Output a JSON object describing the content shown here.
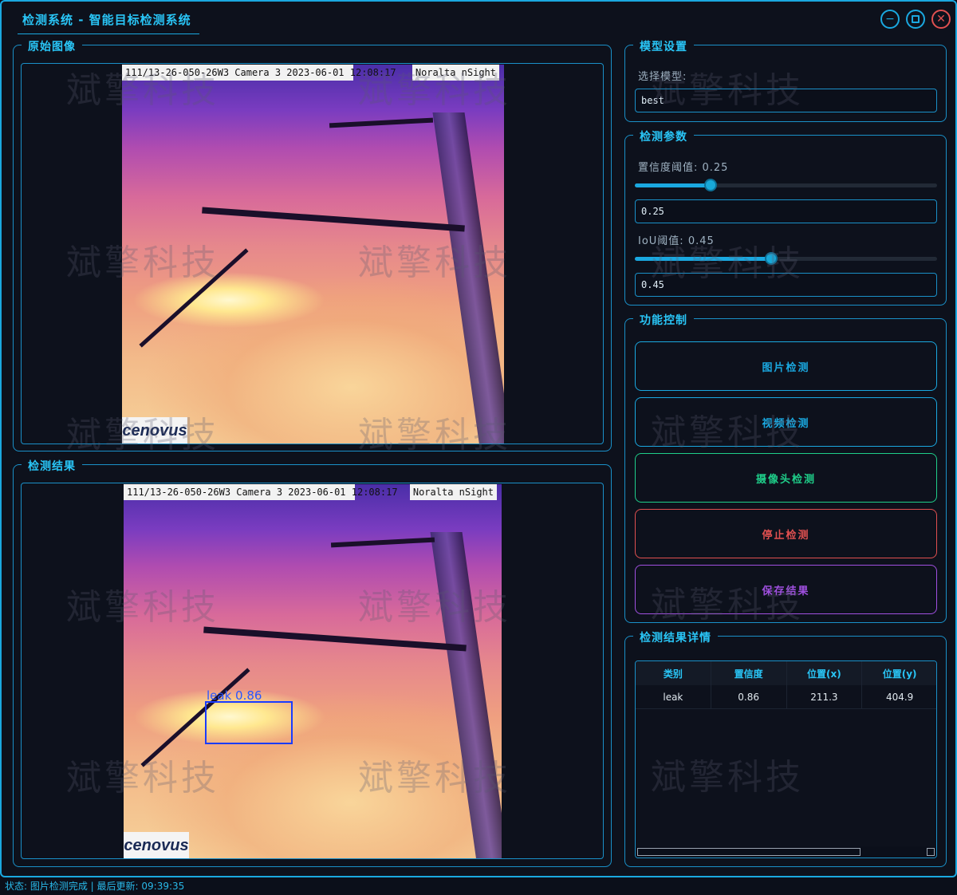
{
  "window": {
    "title": "检测系统 - 智能目标检测系统",
    "minimize_icon": "minimize-icon",
    "maximize_icon": "maximize-icon",
    "close_icon": "close-icon"
  },
  "watermark_text": "斌擎科技",
  "original_panel": {
    "title": "原始图像",
    "camera_stamp": "111/13-26-050-26W3 Camera 3 2023-06-01 12:08:17",
    "brand_stamp": "Noralta nSight",
    "logo_text": "cenovus"
  },
  "result_panel": {
    "title": "检测结果",
    "camera_stamp": "111/13-26-050-26W3 Camera 3 2023-06-01 12:08:17",
    "brand_stamp": "Noralta nSight",
    "logo_text": "cenovus",
    "detection_label": "leak 0.86"
  },
  "model_settings": {
    "title": "模型设置",
    "select_label": "选择模型:",
    "model_value": "best"
  },
  "detect_params": {
    "title": "检测参数",
    "conf_label": "置信度阈值: 0.25",
    "conf_value": 0.25,
    "conf_input": "0.25",
    "iou_label": "IoU阈值: 0.45",
    "iou_value": 0.45,
    "iou_input": "0.45"
  },
  "controls": {
    "title": "功能控制",
    "image_detect": "图片检测",
    "video_detect": "视频检测",
    "camera_detect": "摄像头检测",
    "stop_detect": "停止检测",
    "save_result": "保存结果",
    "colors": {
      "image": "#1aa8e0",
      "video": "#1aa8e0",
      "camera": "#1fcf8a",
      "stop": "#e05050",
      "save": "#a050e0"
    }
  },
  "results_detail": {
    "title": "检测结果详情",
    "columns": [
      "类别",
      "置信度",
      "位置(x)",
      "位置(y)"
    ],
    "rows": [
      [
        "leak",
        "0.86",
        "211.3",
        "404.9"
      ]
    ]
  },
  "status_bar": {
    "text": "状态: 图片检测完成 | 最后更新: 09:39:35"
  }
}
